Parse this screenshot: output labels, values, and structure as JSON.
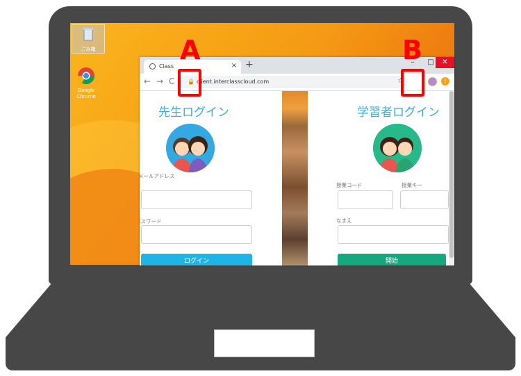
{
  "desktop": {
    "icons": [
      {
        "label": "ごみ箱",
        "icon": "recycle-bin-icon"
      },
      {
        "label": "Google Chrome",
        "icon": "chrome-icon"
      }
    ]
  },
  "browser": {
    "tab_title": "Class",
    "url": "client.interclasscloud.com",
    "window_controls": {
      "minimize": "–",
      "maximize": "□",
      "close": "✕"
    }
  },
  "teacher": {
    "title": "先生ログイン",
    "email_label": "メールアドレス",
    "password_label": "パスワード",
    "login_button": "ログイン"
  },
  "learner": {
    "title": "学習者ログイン",
    "class_code_label": "授業コード",
    "class_key_label": "授業キー",
    "name_label": "なまえ",
    "start_button": "開始"
  },
  "markers": {
    "a": "A",
    "b": "B",
    "color": "#ff0000"
  },
  "colors": {
    "teacher_accent": "#3aaee0",
    "learner_accent": "#15a77e",
    "laptop": "#474747"
  }
}
